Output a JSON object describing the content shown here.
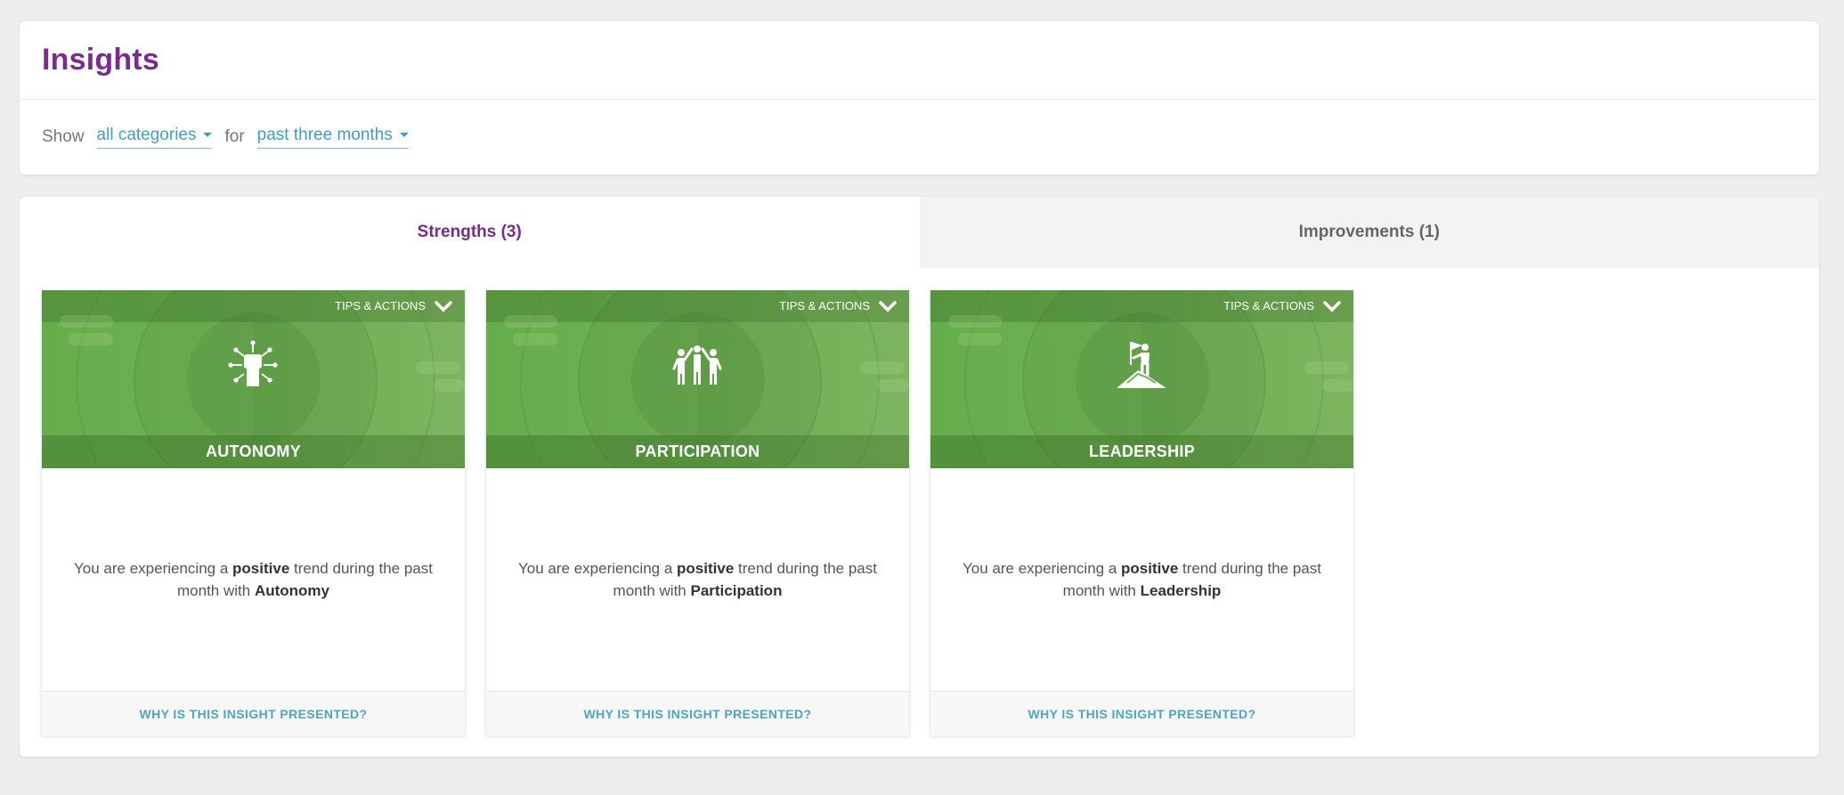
{
  "header": {
    "title": "Insights"
  },
  "filters": {
    "show_label": "Show",
    "category_value": "all categories",
    "for_label": "for",
    "period_value": "past three months"
  },
  "tabs": [
    {
      "label": "Strengths (3)",
      "active": true
    },
    {
      "label": "Improvements (1)",
      "active": false
    }
  ],
  "cards": [
    {
      "tips_label": "TIPS & ACTIONS",
      "category": "AUTONOMY",
      "icon": "raised-fist-icon",
      "text_prefix": "You are experiencing a",
      "text_emphasis": "positive",
      "text_middle": "trend during the past month with",
      "text_subject": "Autonomy",
      "footer_link": "WHY IS THIS INSIGHT PRESENTED?"
    },
    {
      "tips_label": "TIPS & ACTIONS",
      "category": "PARTICIPATION",
      "icon": "group-people-icon",
      "text_prefix": "You are experiencing a",
      "text_emphasis": "positive",
      "text_middle": "trend during the past month with",
      "text_subject": "Participation",
      "footer_link": "WHY IS THIS INSIGHT PRESENTED?"
    },
    {
      "tips_label": "TIPS & ACTIONS",
      "category": "LEADERSHIP",
      "icon": "mountain-flag-icon",
      "text_prefix": "You are experiencing a",
      "text_emphasis": "positive",
      "text_middle": "trend during the past month with",
      "text_subject": "Leadership",
      "footer_link": "WHY IS THIS INSIGHT PRESENTED?"
    }
  ],
  "colors": {
    "title": "#7b2a8f",
    "link": "#3f9fbc",
    "banner_green": "#6fb356"
  }
}
